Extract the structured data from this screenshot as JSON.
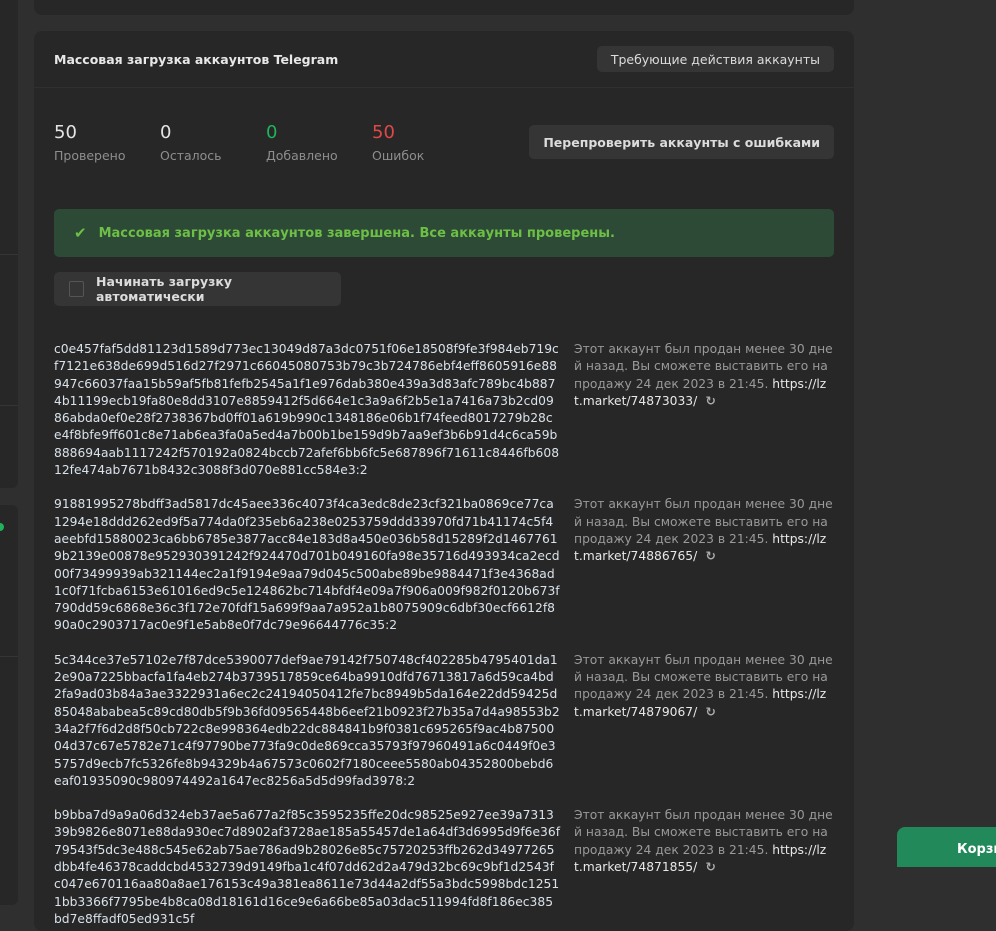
{
  "title": "Массовая загрузка аккаунтов Telegram",
  "action_required_button": "Требующие действия аккаунты",
  "stats": [
    {
      "value": "50",
      "label": "Проверено",
      "color": "#e4e4e4"
    },
    {
      "value": "0",
      "label": "Осталось",
      "color": "#e4e4e4"
    },
    {
      "value": "0",
      "label": "Добавлено",
      "color": "#1fb35b"
    },
    {
      "value": "50",
      "label": "Ошибок",
      "color": "#e04848"
    }
  ],
  "recheck_button": "Перепроверить аккаунты с ошибками",
  "alert": {
    "text": "Массовая загрузка аккаунтов завершена. Все аккаунты проверены.",
    "icon": "check-icon"
  },
  "auto_checkbox": {
    "label": "Начинать загрузку автоматически",
    "checked": false
  },
  "items": [
    {
      "hash": "c0e457faf5dd81123d1589d773ec13049d87a3dc0751f06e18508f9fe3f984eb719cf7121e638de699d516d27f2971c66045080753b79c3b724786ebf4eff8605916e88947c66037faa15b59af5fb81fefb2545a1f1e976dab380e439a3d83afc789bc4b8874b11199ecb19fa80e8dd3107e8859412f5d664e1c3a9a6f2b5e1a7416a73b2cd0986abda0ef0e28f2738367bd0ff01a619b990c1348186e06b1f74feed8017279b28ce4f8bfe9ff601c8e71ab6ea3fa0a5ed4a7b00b1be159d9b7aa9ef3b6b91d4c6ca59b888694aab1117242f570192a0824bccb72afef6bb6fc5e687896f71611c8446fb60812fe474ab7671b8432c3088f3d070e881cc584e3:2",
      "note": "Этот аккаунт был продан менее 30 дней назад. Вы сможете выставить его на продажу 24 дек 2023 в 21:45.",
      "link": "https://lzt.market/74873033/"
    },
    {
      "hash": "91881995278bdff3ad5817dc45aee336c4073f4ca3edc8de23cf321ba0869ce77ca1294e18ddd262ed9f5a774da0f235eb6a238e0253759ddd33970fd71b41174c5f4aeebfd15880023ca6bb6785e3877acc84e183d8a450e036b58d15289f2d14677619b2139e00878e952930391242f924470d701b049160fa98e35716d493934ca2ecd00f73499939ab321144ec2a1f9194e9aa79d045c500abe89be9884471f3e4368ad1c0f71fcba6153e61016ed9c5e124862bc714bfdf4e09a7f906a009f982f0120b673f790dd59c6868e36c3f172e70fdf15a699f9aa7a952a1b8075909c6dbf30ecf6612f890a0c2903717ac0e9f1e5ab8e0f7dc79e96644776c35:2",
      "note": "Этот аккаунт был продан менее 30 дней назад. Вы сможете выставить его на продажу 24 дек 2023 в 21:45.",
      "link": "https://lzt.market/74886765/"
    },
    {
      "hash": "5c344ce37e57102e7f87dce5390077def9ae79142f750748cf402285b4795401da12e90a7225bbacfa1fa4eb274b3739517859ce64ba9910dfd76713817a6d59ca4bd2fa9ad03b84a3ae3322931a6ec2c24194050412fe7bc8949b5da164e22dd59425d85048ababea5c89cd80db5f9b36fd09565448b6eef21b0923f27b35a7d4a98553b234a2f7f6d2d8f50cb722c8e998364edb22dc884841b9f0381c695265f9ac4b8750004d37c67e5782e71c4f97790be773fa9c0de869cca35793f97960491a6c0449f0e35757d9ecb7fc5326fe8b94329b4a67573c0602f7180ceee5580ab04352800bebd6eaf01935090c980974492a1647ec8256a5d5d99fad3978:2",
      "note": "Этот аккаунт был продан менее 30 дней назад. Вы сможете выставить его на продажу 24 дек 2023 в 21:45.",
      "link": "https://lzt.market/74879067/"
    },
    {
      "hash": "b9bba7d9a9a06d324eb37ae5a677a2f85c3595235ffe20dc98525e927ee39a731339b9826e8071e88da930ec7d8902af3728ae185a55457de1a64df3d6995d9f6e36f79543f5dc3e488c545e62ab75ae786ad9b28026e85c75720253ffb262d34977265dbb4fe46378caddcbd4532739d9149fba1c4f07dd62d2a479d32bc69c9bf1d2543fc047e670116aa80a8ae176153c49a381ea8611e73d44a2df55a3bdc5998bdc12511bb3366f7795be4b8ca08d18161d16ce9e6a66be85a03dac511994fd8f186ec385bd7e8ffadf05ed931c5f",
      "note": "Этот аккаунт был продан менее 30 дней назад. Вы сможете выставить его на продажу 24 дек 2023 в 21:45.",
      "link": "https://lzt.market/74871855/"
    }
  ],
  "cart_button": "Корзи"
}
